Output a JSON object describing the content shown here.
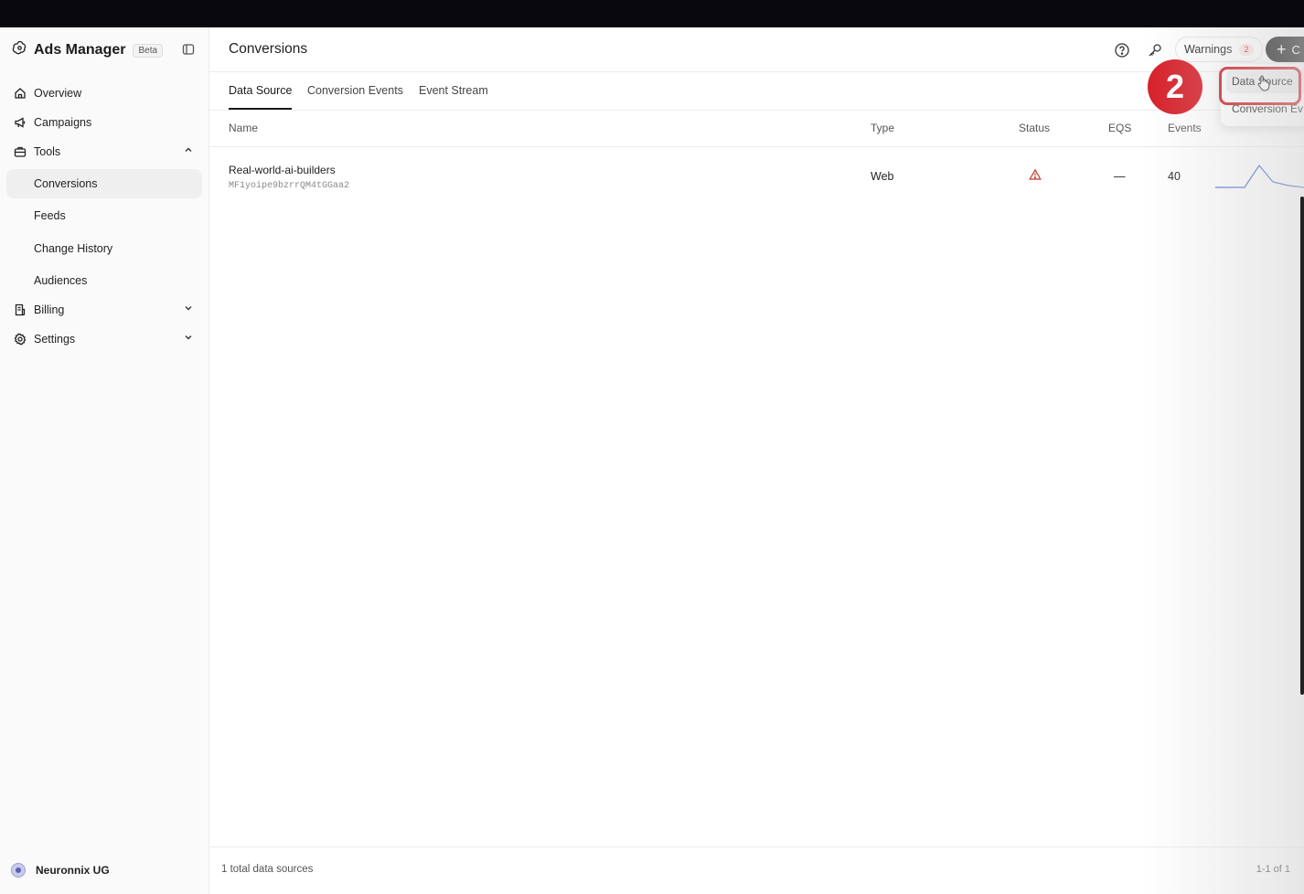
{
  "brand": {
    "name": "Ads Manager",
    "badge": "Beta"
  },
  "sidebar": {
    "items": [
      {
        "label": "Overview",
        "icon": "home-icon"
      },
      {
        "label": "Campaigns",
        "icon": "megaphone-icon"
      },
      {
        "label": "Tools",
        "icon": "toolbox-icon",
        "expanded": true
      },
      {
        "label": "Billing",
        "icon": "receipt-icon",
        "expanded": false
      },
      {
        "label": "Settings",
        "icon": "gear-icon",
        "expanded": false
      }
    ],
    "tools_sub": [
      {
        "label": "Conversions",
        "active": true
      },
      {
        "label": "Feeds"
      },
      {
        "label": "Change History"
      },
      {
        "label": "Audiences"
      }
    ],
    "account": "Neuronnix UG"
  },
  "header": {
    "title": "Conversions",
    "warnings_label": "Warnings",
    "warnings_count": "2",
    "create_label": "C"
  },
  "tabs": [
    {
      "label": "Data Source",
      "active": true
    },
    {
      "label": "Conversion Events"
    },
    {
      "label": "Event Stream"
    }
  ],
  "table": {
    "columns": [
      "Name",
      "Type",
      "Status",
      "EQS",
      "Events"
    ],
    "rows": [
      {
        "name": "Real-world-ai-builders",
        "id": "MF1yoipe9bzrrQM4tGGaa2",
        "type": "Web",
        "status": "warning-icon",
        "eqs": "—",
        "events": "40"
      }
    ]
  },
  "dropdown": {
    "items": [
      "Data Source",
      "Conversion Ev"
    ]
  },
  "annotation": {
    "number": "2",
    "color": "#d21f28"
  },
  "footer": {
    "total": "1 total data sources",
    "pagination": "1-1 of 1"
  },
  "colors": {
    "accent_dark": "#1d1d1d",
    "warning_red": "#c0392b",
    "sparkline": "#4a6fd1"
  }
}
